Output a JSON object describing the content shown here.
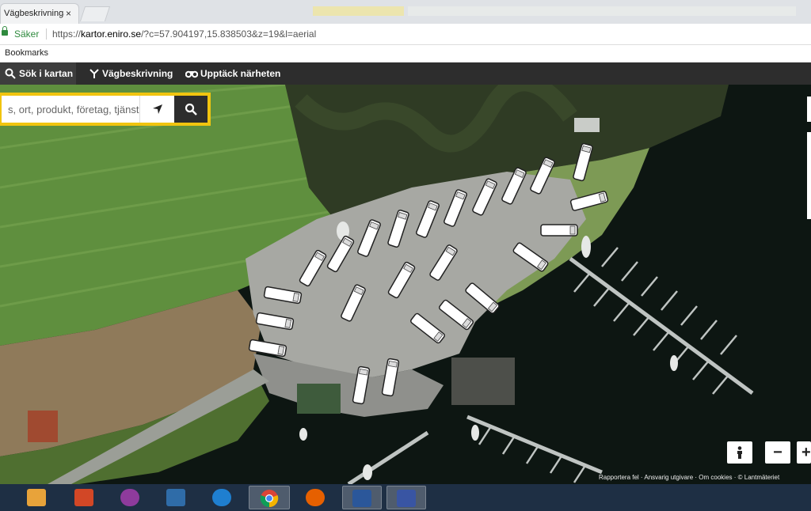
{
  "browser": {
    "tab_title": "Vägbeskrivningar",
    "tab_close": "×",
    "secure_label": "Säker",
    "url_prefix": "https://",
    "url_host": "kartor.eniro.se",
    "url_rest": "/?c=57.904197,15.838503&z=19&l=aerial",
    "bookmarks_label": "Bookmarks"
  },
  "nav": {
    "items": [
      {
        "label": "Sök i kartan",
        "icon": "search-icon"
      },
      {
        "label": "Vägbeskrivning",
        "icon": "route-icon"
      },
      {
        "label": "Upptäck närheten",
        "icon": "binoculars-icon"
      }
    ]
  },
  "search": {
    "placeholder": "s, ort, produkt, företag, tjänst"
  },
  "map": {
    "mode": "aerial",
    "person_icon": "pegman-icon",
    "zoom_out": "−",
    "zoom_in": "+",
    "credits": "Rapportera fel · Ansvarig utgivare · Om cookies · © Lantmäteriet"
  },
  "taskbar": {
    "apps": [
      "outlook-icon",
      "powerpoint-icon",
      "onenote-icon",
      "media-icon",
      "internet-explorer-icon",
      "chrome-icon",
      "firefox-icon",
      "word-icon",
      "visio-icon"
    ]
  },
  "colors": {
    "accent": "#f1c40f",
    "navbar": "#2d2d2d",
    "secure": "#2f8a3e"
  }
}
